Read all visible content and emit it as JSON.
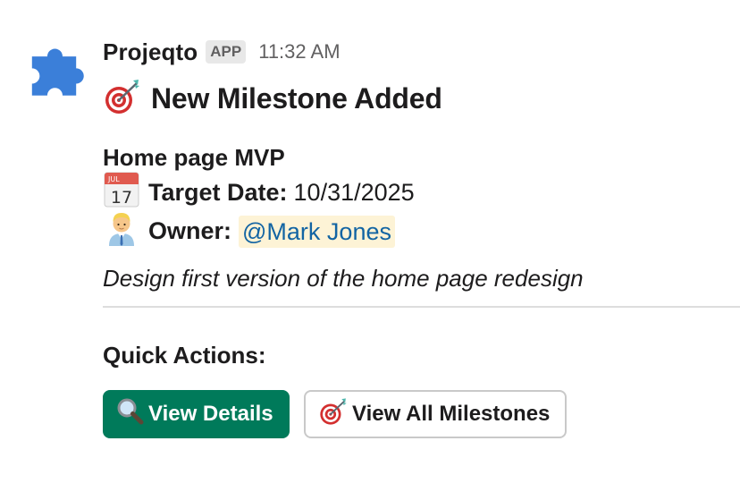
{
  "app": {
    "name": "Projeqto",
    "badge": "APP",
    "timestamp": "11:32 AM"
  },
  "message": {
    "title": "New Milestone Added",
    "title_icon": "direct-hit-target-icon",
    "milestone_name": "Home page MVP",
    "target_date_label": "Target Date:",
    "target_date_value": "10/31/2025",
    "target_date_icon": "calendar-icon",
    "calendar_month": "JUL",
    "calendar_day": "17",
    "owner_label": "Owner:",
    "owner_value": "@Mark Jones",
    "owner_icon": "office-worker-icon",
    "description": "Design first version of the home page redesign"
  },
  "quick_actions": {
    "heading": "Quick Actions:",
    "buttons": [
      {
        "label": "View Details",
        "icon": "magnifying-glass-icon",
        "style": "primary"
      },
      {
        "label": "View All Milestones",
        "icon": "direct-hit-target-icon",
        "style": "secondary"
      }
    ]
  },
  "colors": {
    "primary_button": "#007a5a",
    "mention_background": "#fdf3d6",
    "mention_text": "#1264a3",
    "avatar": "#3b7fd9"
  }
}
